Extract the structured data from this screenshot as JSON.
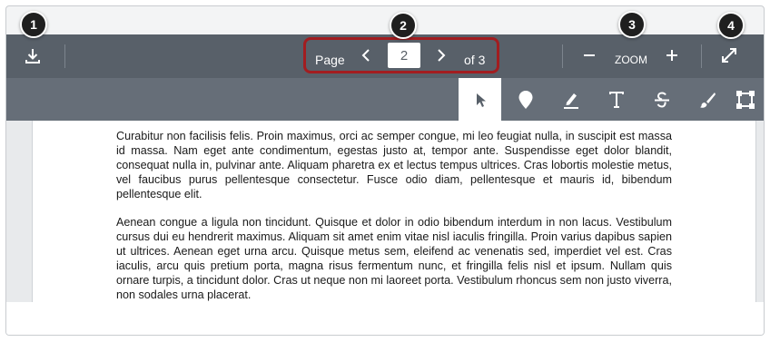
{
  "toolbar": {
    "page_label": "Page",
    "current_page": "2",
    "total_label": "of 3",
    "zoom_label": "ZOOM"
  },
  "icons": {
    "download": "download-icon",
    "prev": "chevron-left-icon",
    "next": "chevron-right-icon",
    "zoom_out": "minus-icon",
    "zoom_in": "plus-icon",
    "fullscreen": "expand-icon"
  },
  "annotation_tools": [
    {
      "name": "select-tool",
      "icon": "cursor-icon",
      "active": true
    },
    {
      "name": "point-tool",
      "icon": "map-pin-icon",
      "active": false
    },
    {
      "name": "highlight-tool",
      "icon": "highlighter-icon",
      "active": false
    },
    {
      "name": "text-tool",
      "icon": "text-icon",
      "active": false
    },
    {
      "name": "strikeout-tool",
      "icon": "strikethrough-icon",
      "active": false
    },
    {
      "name": "draw-tool",
      "icon": "brush-icon",
      "active": false
    },
    {
      "name": "area-tool",
      "icon": "area-box-icon",
      "active": false
    }
  ],
  "callouts": [
    "1",
    "2",
    "3",
    "4"
  ],
  "document": {
    "paragraphs": [
      "Curabitur non facilisis felis. Proin maximus, orci ac semper congue, mi leo feugiat nulla, in suscipit est massa id massa. Nam eget ante condimentum, egestas justo at, tempor ante. Suspendisse eget dolor blandit, consequat nulla in, pulvinar ante. Aliquam pharetra ex et lectus tempus ultrices. Cras lobortis molestie metus, vel faucibus purus pellentesque consectetur. Fusce odio diam, pellentesque et mauris id, bibendum pellentesque elit.",
      "Aenean congue a ligula non tincidunt. Quisque et dolor in odio bibendum interdum in non lacus. Vestibulum cursus dui eu hendrerit maximus. Aliquam sit amet enim vitae nisl iaculis fringilla. Proin varius dapibus sapien ut ultrices. Aenean eget urna arcu. Quisque metus sem, eleifend ac venenatis sed, imperdiet vel est. Cras iaculis, arcu quis pretium porta, magna risus fermentum nunc, et fringilla felis nisl et ipsum. Nullam quis ornare turpis, a tincidunt dolor. Cras ut neque non mi laoreet porta. Vestibulum rhoncus sem non justo viverra, non sodales urna placerat."
    ]
  },
  "colors": {
    "toolbar_primary": "#586069",
    "toolbar_secondary": "#666e78",
    "callout_highlight": "#a21d20"
  }
}
